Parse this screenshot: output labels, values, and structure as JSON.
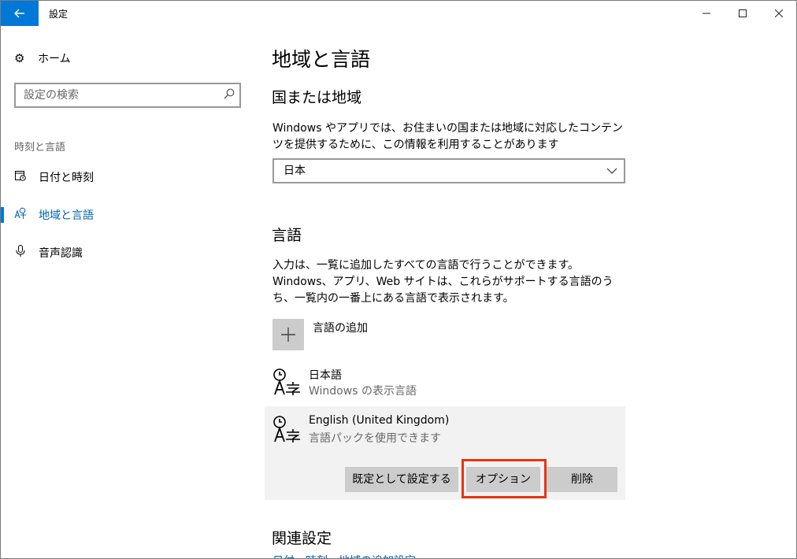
{
  "window": {
    "title": "設定"
  },
  "nav": {
    "home": "ホーム",
    "search_placeholder": "設定の検索",
    "section": "時刻と言語",
    "items": [
      {
        "label": "日付と時刻",
        "icon": "calendar-clock-icon"
      },
      {
        "label": "地域と言語",
        "icon": "region-language-icon",
        "active": true
      },
      {
        "label": "音声認識",
        "icon": "microphone-icon"
      }
    ]
  },
  "main": {
    "title": "地域と言語",
    "country": {
      "heading": "国または地域",
      "description": "Windows やアプリでは、お住まいの国または地域に対応したコンテンツを提供するために、この情報を利用することがあります",
      "selected": "日本"
    },
    "language": {
      "heading": "言語",
      "description": "入力は、一覧に追加したすべての言語で行うことができます。Windows、アプリ、Web サイトは、これらがサポートする言語のうち、一覧内の一番上にある言語で表示されます。",
      "add_label": "言語の追加",
      "items": [
        {
          "name": "日本語",
          "sub": "Windows の表示言語"
        },
        {
          "name": "English (United Kingdom)",
          "sub": "言語パックを使用できます"
        }
      ],
      "buttons": {
        "set_default": "既定として設定する",
        "options": "オプション",
        "remove": "削除"
      }
    },
    "related": {
      "heading": "関連設定",
      "link": "日付、時刻、地域の追加設定"
    }
  },
  "colors": {
    "accent": "#0078d7",
    "highlight": "#e8340f",
    "selected_bg": "#f2f2f2",
    "button_bg": "#cccccc"
  }
}
